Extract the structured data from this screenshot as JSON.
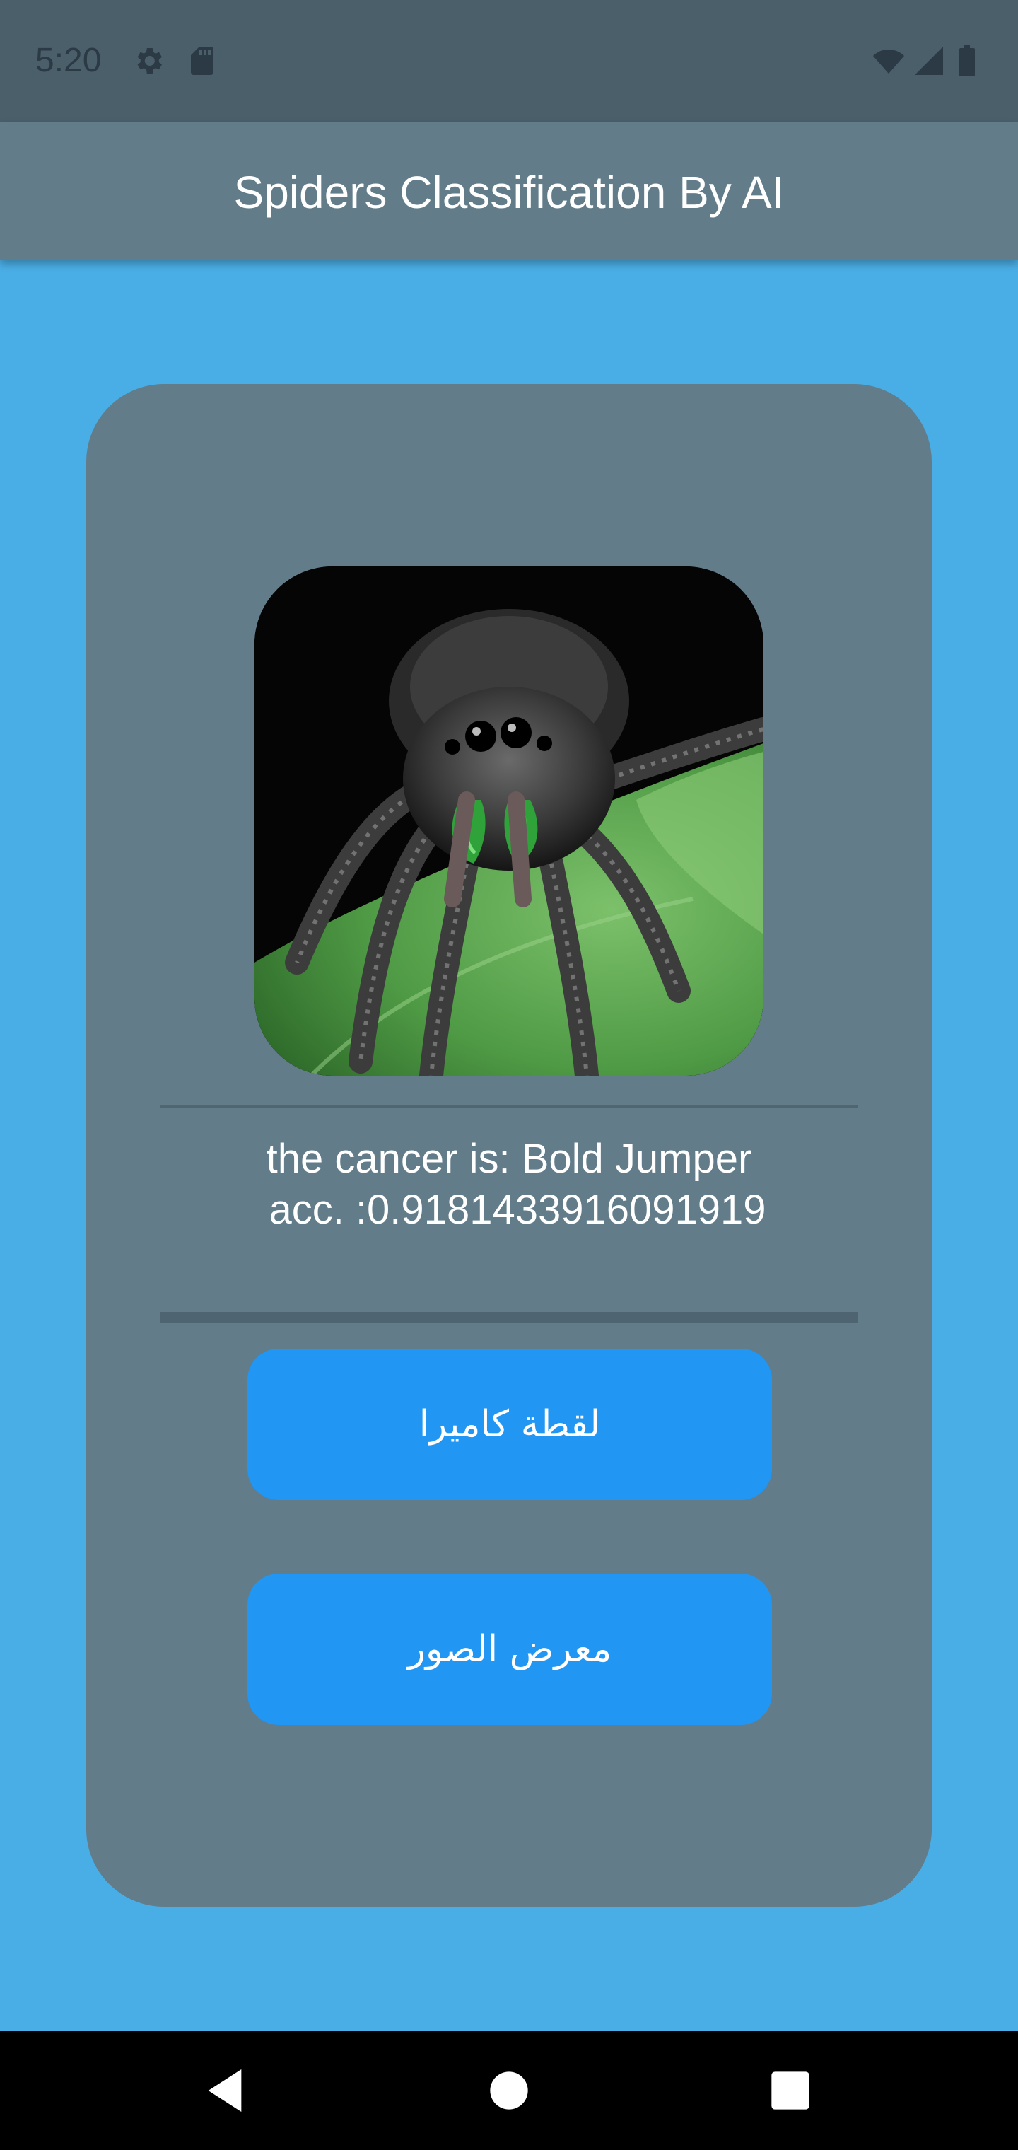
{
  "status_bar": {
    "time": "5:20",
    "icons": [
      "gear-icon",
      "sd-card-icon",
      "wifi-icon",
      "cell-signal-icon",
      "battery-icon"
    ]
  },
  "app_bar": {
    "title": "Spiders Classification By AI"
  },
  "result": {
    "image_alt": "jumping spider on green leaf",
    "line1": "the cancer is: Bold Jumper",
    "line2": "acc. :0.9181433916091919"
  },
  "buttons": {
    "camera_label": "لقطة كاميرا",
    "gallery_label": "معرض الصور"
  },
  "nav_bar": {
    "icons": [
      "back-icon",
      "home-icon",
      "recents-icon"
    ]
  },
  "colors": {
    "background": "#4aaee6",
    "status_bar": "#4b5f6b",
    "app_bar": "#627c8a",
    "card": "#627c8a",
    "button": "#2196f3"
  }
}
